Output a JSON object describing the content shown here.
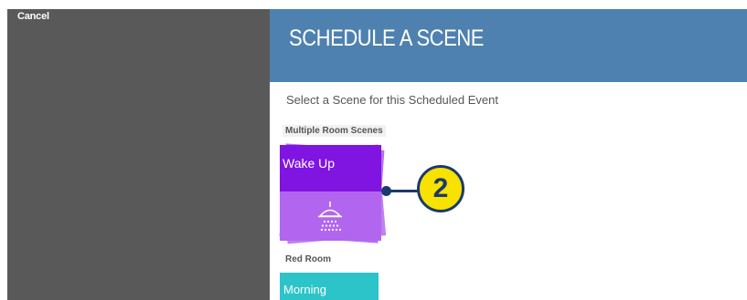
{
  "window": {
    "cancel_label": "Cancel"
  },
  "header": {
    "title": "SCHEDULE A SCENE"
  },
  "main": {
    "prompt": "Select a Scene for this Scheduled Event",
    "sections": [
      {
        "label": "Multiple Room Scenes",
        "scenes": [
          {
            "label": "Wake Up",
            "icon": "shower-icon",
            "color_top": "#8014e0",
            "color_bottom": "#b266f0"
          }
        ]
      },
      {
        "label": "Red Room",
        "scenes": [
          {
            "label": "Morning",
            "color": "#2cc4c9"
          }
        ]
      }
    ]
  },
  "callout": {
    "number": "2"
  },
  "colors": {
    "header_bg": "#4e81b0",
    "left_panel_bg": "#595959",
    "callout_fill": "#f7e200",
    "callout_stroke": "#1b3a6b"
  }
}
